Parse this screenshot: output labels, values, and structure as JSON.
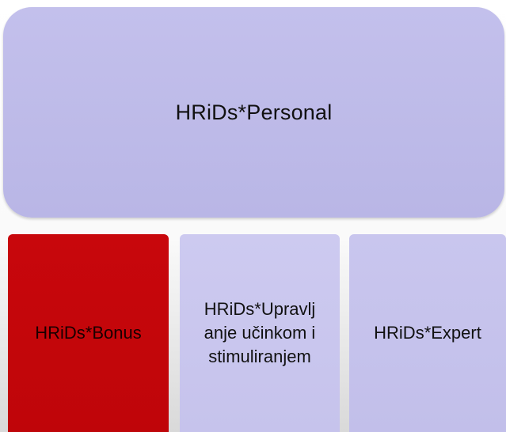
{
  "diagram": {
    "top_box": {
      "label": "HRiDs*Personal",
      "color": "#bdbae8"
    },
    "modules": [
      {
        "label": "HRiDs*Bonus",
        "color": "#c4060a"
      },
      {
        "label": "HRiDs*Upravlj\nanje učinkom i\nstimuliranjem",
        "color": "#c9c6ee"
      },
      {
        "label": "HRiDs*Expert",
        "color": "#c5c2ec"
      }
    ]
  }
}
